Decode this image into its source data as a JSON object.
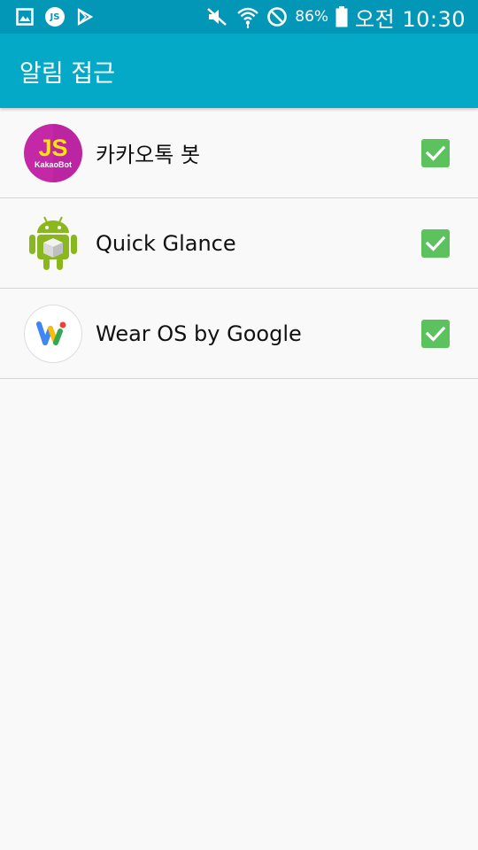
{
  "status_bar": {
    "left_icons": [
      "gallery-icon",
      "kakaobot-js-icon",
      "play-store-icon"
    ],
    "js_badge": "JS",
    "right_icons": [
      "mute-icon",
      "wifi-icon",
      "blocked-icon",
      "battery-icon"
    ],
    "battery": "86%",
    "time": "오전 10:30"
  },
  "app_bar": {
    "title": "알림 접근"
  },
  "apps": [
    {
      "name": "카카오톡 봇",
      "icon": "kakaobot-icon",
      "icon_text": "JS",
      "icon_subtext": "KakaoBot",
      "checked": true
    },
    {
      "name": "Quick Glance",
      "icon": "android-icon",
      "checked": true
    },
    {
      "name": "Wear OS by Google",
      "icon": "wear-os-icon",
      "checked": true
    }
  ],
  "colors": {
    "status_bar": "#0297b6",
    "app_bar": "#03a9c6",
    "checkbox": "#5cc25e",
    "background": "#f9f9f9"
  }
}
